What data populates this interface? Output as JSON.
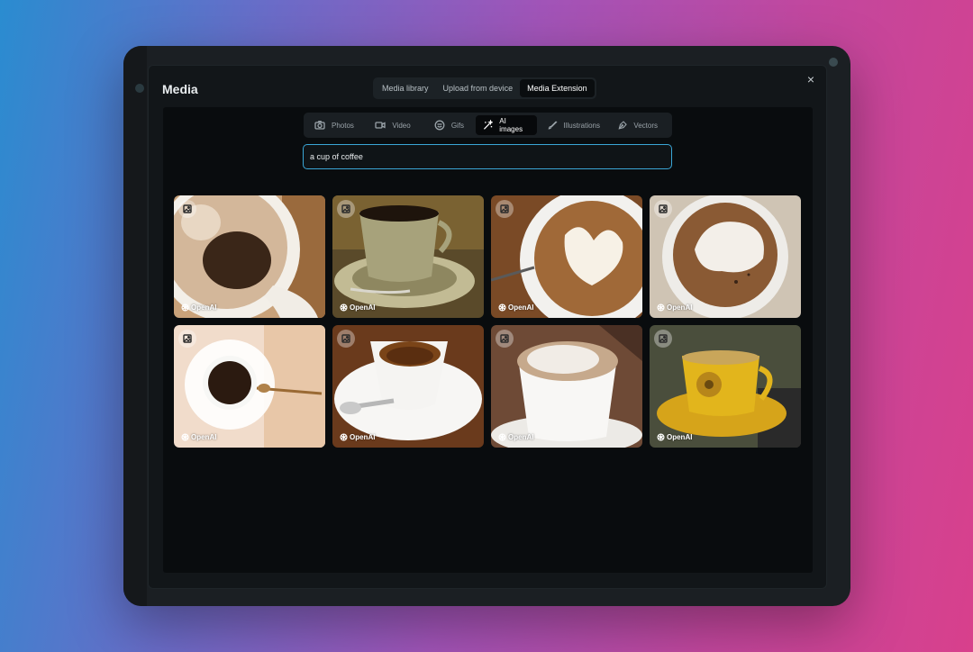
{
  "modal": {
    "title": "Media",
    "close_label": "×"
  },
  "top_tabs": [
    {
      "label": "Media library",
      "active": false
    },
    {
      "label": "Upload from device",
      "active": false
    },
    {
      "label": "Media Extension",
      "active": true
    }
  ],
  "sub_tabs": [
    {
      "label": "Photos",
      "icon": "camera-icon",
      "active": false
    },
    {
      "label": "Video",
      "icon": "video-icon",
      "active": false
    },
    {
      "label": "Gifs",
      "icon": "smiley-icon",
      "active": false
    },
    {
      "label": "AI images",
      "icon": "magic-wand-icon",
      "active": true
    },
    {
      "label": "Illustrations",
      "icon": "brush-icon",
      "active": false
    },
    {
      "label": "Vectors",
      "icon": "pen-tool-icon",
      "active": false
    }
  ],
  "search": {
    "value": "a cup of coffee"
  },
  "results": [
    {
      "credit": "OpenAI",
      "subject": "black-coffee-top-view"
    },
    {
      "credit": "OpenAI",
      "subject": "espresso-cup-saucer"
    },
    {
      "credit": "OpenAI",
      "subject": "latte-art-heart"
    },
    {
      "credit": "OpenAI",
      "subject": "cappuccino-foam"
    },
    {
      "credit": "OpenAI",
      "subject": "black-coffee-spoon"
    },
    {
      "credit": "OpenAI",
      "subject": "espresso-white-cup"
    },
    {
      "credit": "OpenAI",
      "subject": "cappuccino-white-cup"
    },
    {
      "credit": "OpenAI",
      "subject": "floral-yellow-cup"
    }
  ],
  "colors": {
    "accent": "#3aa6d6",
    "modal_bg": "#121619",
    "panel_bg": "#090c0e"
  }
}
